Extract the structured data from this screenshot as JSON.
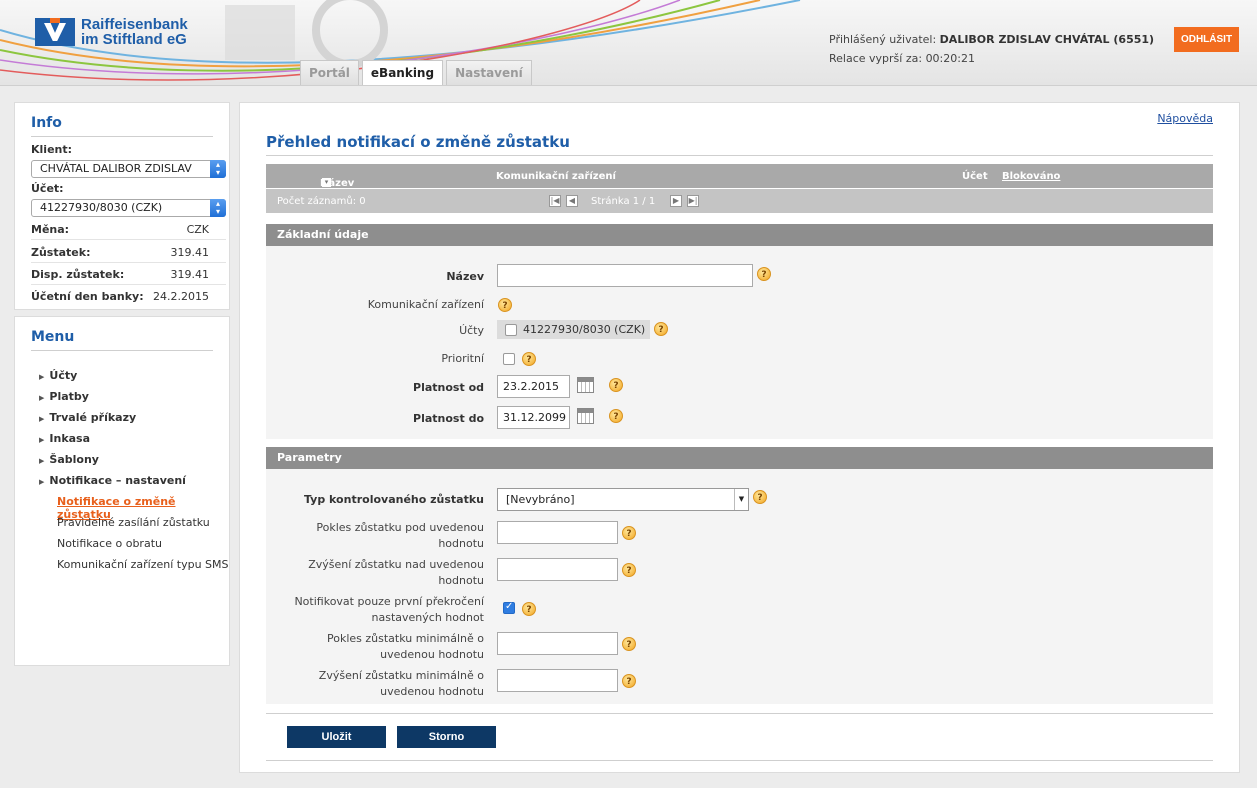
{
  "header": {
    "logo_line1": "Raiffeisenbank",
    "logo_line2": "im Stiftland eG",
    "tabs": [
      {
        "label": "Portál",
        "active": false
      },
      {
        "label": "eBanking",
        "active": true
      },
      {
        "label": "Nastavení",
        "active": false
      }
    ],
    "user_label": "Přihlášený uživatel:",
    "user_name": "DALIBOR ZDISLAV CHVÁTAL (6551)",
    "session_label": "Relace vyprší za:",
    "session_time": "00:20:21",
    "logout_label": "ODHLÁSIT"
  },
  "info": {
    "title": "Info",
    "client_label": "Klient:",
    "client_value": "CHVÁTAL DALIBOR ZDISLAV",
    "account_label": "Účet:",
    "account_value": "41227930/8030 (CZK)",
    "currency_label": "Měna:",
    "currency_value": "CZK",
    "balance_label": "Zůstatek:",
    "balance_value": "319.41",
    "avail_label": "Disp. zůstatek:",
    "avail_value": "319.41",
    "bankday_label": "Účetní den banky:",
    "bankday_value": "24.2.2015"
  },
  "menu": {
    "title": "Menu",
    "items": [
      "Účty",
      "Platby",
      "Trvalé příkazy",
      "Inkasa",
      "Šablony",
      "Notifikace – nastavení"
    ],
    "subitems": [
      {
        "label": "Notifikace o změně zůstatku",
        "active": true
      },
      {
        "label": "Pravidelné zasílání zůstatku",
        "active": false
      },
      {
        "label": "Notifikace o obratu",
        "active": false
      },
      {
        "label": "Komunikační zařízení typu SMS",
        "active": false
      }
    ]
  },
  "main": {
    "help_link": "Nápověda",
    "title": "Přehled notifikací o změně zůstatku",
    "grid": {
      "col_name": "Název",
      "col_device": "Komunikační zařízení",
      "col_account": "Účet",
      "col_blocked": "Blokováno",
      "records": "Počet záznamů: 0",
      "page": "Stránka 1 / 1"
    },
    "section_basic": "Základní údaje",
    "section_params": "Parametry",
    "fields": {
      "name_label": "Název",
      "name_value": "",
      "device_label": "Komunikační zařízení",
      "accounts_label": "Účty",
      "accounts_option": "41227930/8030 (CZK)",
      "priority_label": "Prioritní",
      "valid_from_label": "Platnost od",
      "valid_from_value": "23.2.2015",
      "valid_to_label": "Platnost do",
      "valid_to_value": "31.12.2099",
      "balance_type_label": "Typ kontrolovaného zůstatku",
      "balance_type_value": "[Nevybráno]",
      "drop_below_label_1": "Pokles zůstatku pod uvedenou",
      "drop_below_label_2": "hodnotu",
      "rise_above_label_1": "Zvýšení zůstatku nad uvedenou",
      "rise_above_label_2": "hodnotu",
      "first_only_label_1": "Notifikovat pouze první překročení",
      "first_only_label_2": "nastavených hodnot",
      "drop_min_label_1": "Pokles zůstatku minimálně o",
      "drop_min_label_2": "uvedenou hodnotu",
      "rise_min_label_1": "Zvýšení zůstatku minimálně o",
      "rise_min_label_2": "uvedenou hodnotu"
    },
    "help_glyph": "?",
    "save_label": "Uložit",
    "cancel_label": "Storno"
  },
  "icons": {
    "sort": "sort-desc-icon",
    "first": "first-page-icon",
    "prev": "prev-page-icon",
    "next": "next-page-icon",
    "last": "last-page-icon",
    "calendar": "calendar-icon",
    "help": "help-icon"
  },
  "colors": {
    "brand_blue": "#1f5ea8",
    "accent_orange": "#f26c1f",
    "button_navy": "#0d3865"
  }
}
